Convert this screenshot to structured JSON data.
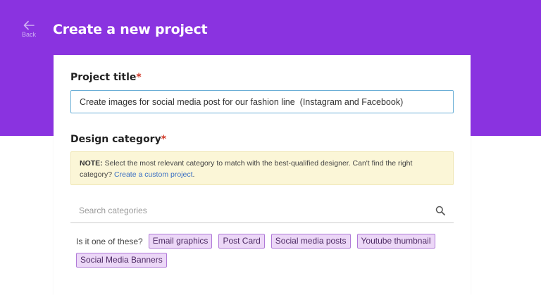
{
  "header": {
    "back_label": "Back",
    "title": "Create a new project",
    "accent_color": "#8a33e0"
  },
  "form": {
    "project_title": {
      "label": "Project title",
      "required_mark": "*",
      "value": "Create images for social media post for our fashion line  (Instagram and Facebook)"
    },
    "design_category": {
      "label": "Design category",
      "required_mark": "*",
      "note": {
        "prefix": "NOTE:",
        "text": " Select the most relevant category to match with the best-qualified designer. Can't find the right category? ",
        "link": "Create a custom project",
        "suffix": "."
      },
      "search": {
        "placeholder": "Search categories",
        "value": ""
      },
      "suggestions": {
        "label": "Is it one of these?",
        "chips": [
          "Email graphics",
          "Post Card",
          "Social media posts",
          "Youtube thumbnail",
          "Social Media Banners"
        ]
      }
    }
  }
}
